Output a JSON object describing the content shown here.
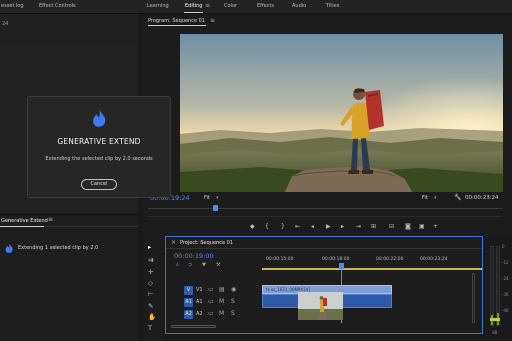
{
  "topbar": {
    "left_labels": [
      "esset log",
      "Effect Controls"
    ],
    "workspaces": [
      "Learning",
      "Editing",
      "Color",
      "Effects",
      "Audio",
      "Titles"
    ],
    "active_workspace": "Editing"
  },
  "left_top_panel": {
    "sub_label": "24"
  },
  "dialog": {
    "title": "GENERATIVE EXTEND",
    "message": "Extending the selected clip by 2.0 seconds",
    "cancel_label": "Cancel"
  },
  "gen_panel": {
    "title": "Generative Extend",
    "status": "Extending 1 selected clip by 2.0"
  },
  "program_monitor": {
    "title": "Program: Sequence 01",
    "timecode_current": "00:00:19:24",
    "fit_left": "Fit",
    "fit_right": "Fit",
    "timecode_duration": "00:00:23:24"
  },
  "timeline": {
    "sequence_name": "Project: Sequence 01",
    "timecode": "00:00:19:00",
    "ruler": [
      "00:00:15:00",
      "00:00:18:00",
      "00:00:22:00",
      "00:00:23:24"
    ],
    "tracks": [
      {
        "chip": "V",
        "label": "V1"
      },
      {
        "chip": "A1",
        "label": "A1"
      },
      {
        "chip": "A2",
        "label": "A2"
      }
    ],
    "clip_label": "fx  ss_1031_00MP4 [V]"
  },
  "meters": {
    "labels": [
      "0",
      "-12",
      "-24",
      "-36",
      "-48",
      "dB"
    ]
  },
  "colors": {
    "accent": "#4c8df6",
    "clip_video": "#7f9fd4",
    "clip_audio": "#2d5ba8",
    "flame": "#3d7bf4"
  }
}
